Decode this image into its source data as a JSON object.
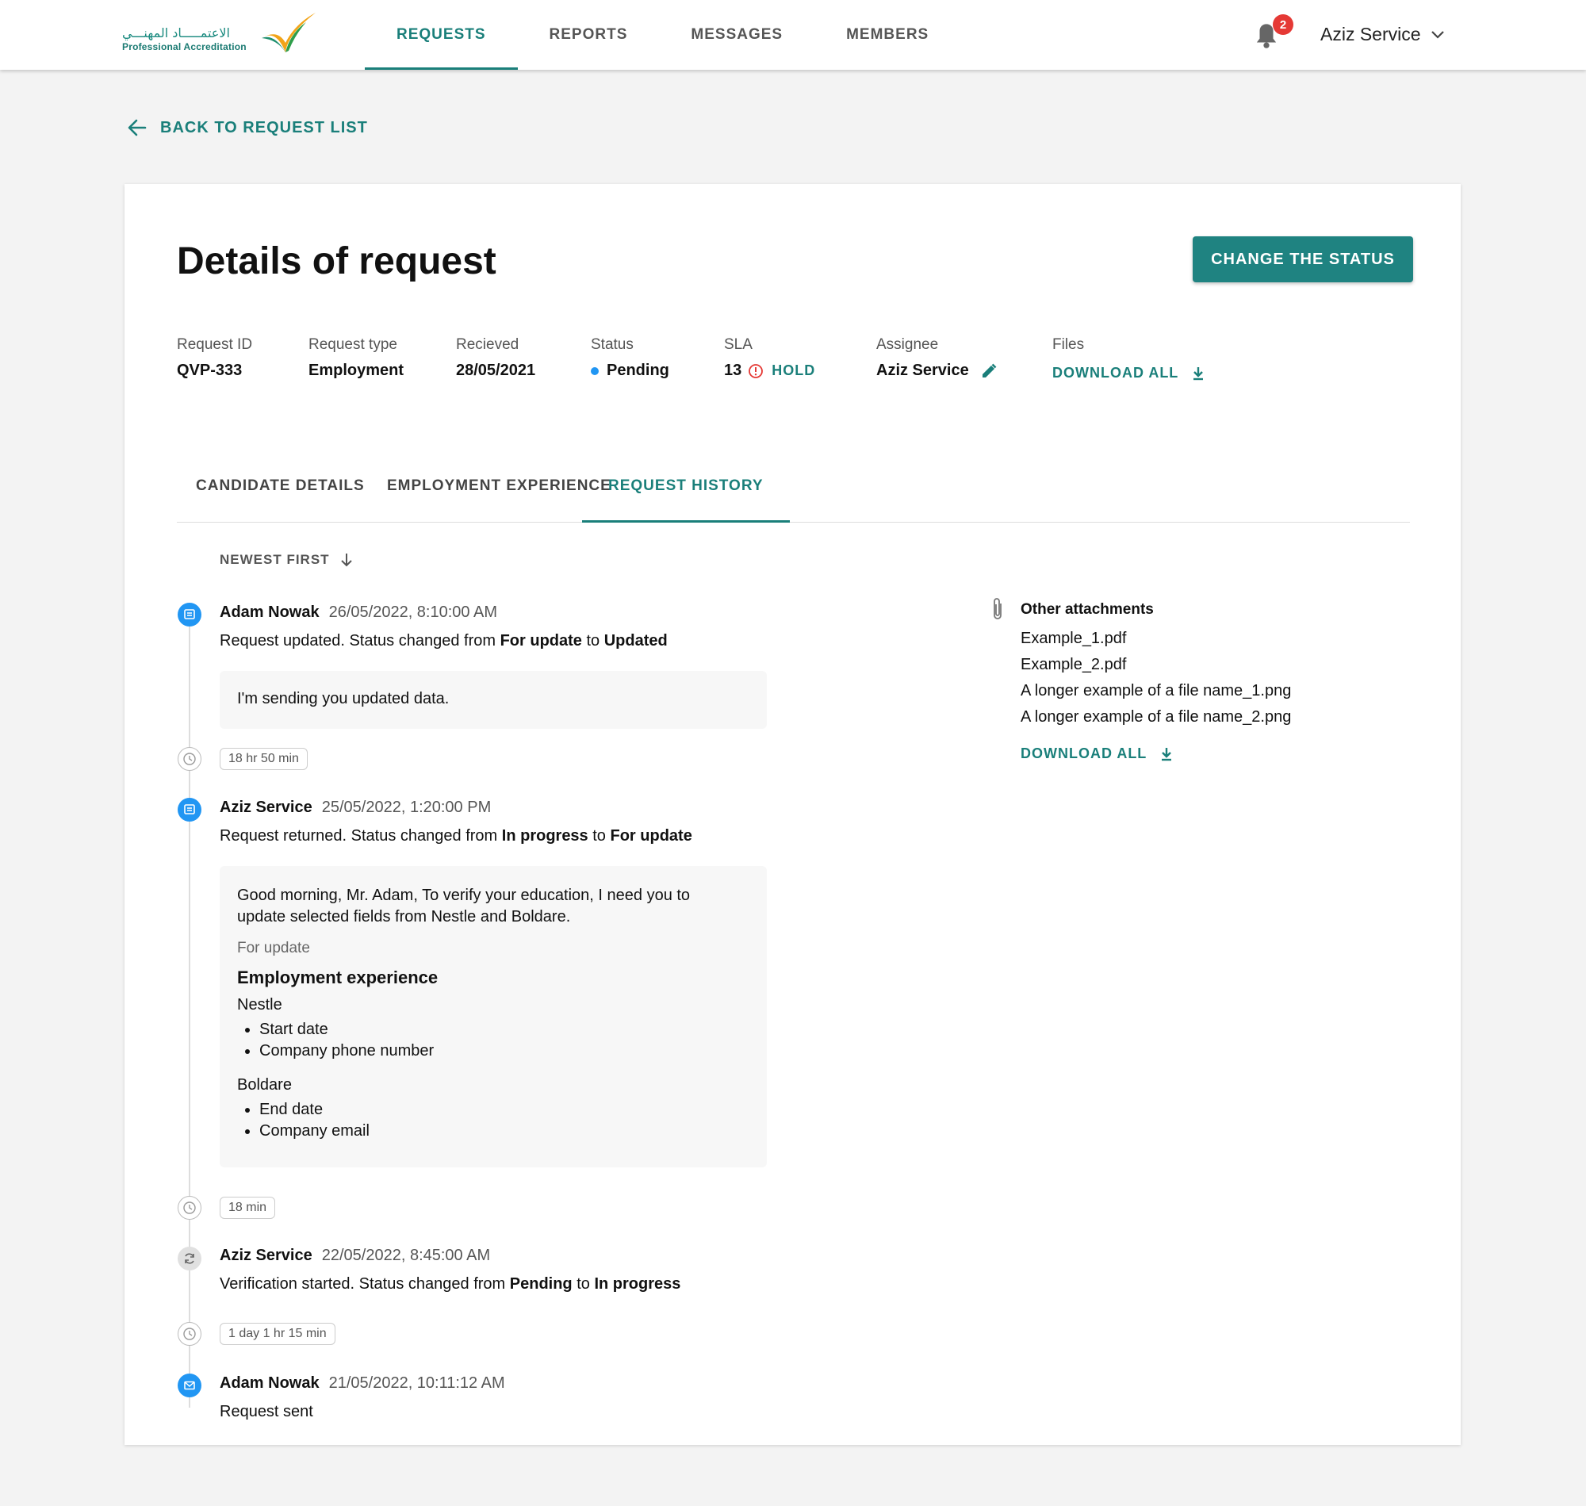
{
  "header": {
    "logo_arabic": "الاعتمـــــاد المهنـــي",
    "logo_english": "Professional Accreditation",
    "nav": [
      {
        "label": "REQUESTS"
      },
      {
        "label": "REPORTS"
      },
      {
        "label": "MESSAGES"
      },
      {
        "label": "MEMBERS"
      }
    ],
    "notifications_count": "2",
    "user_name": "Aziz Service"
  },
  "back_link": "BACK TO REQUEST LIST",
  "page_title": "Details of request",
  "change_status_button": "CHANGE THE STATUS",
  "meta": {
    "request_id": {
      "label": "Request ID",
      "value": "QVP-333"
    },
    "request_type": {
      "label": "Request type",
      "value": "Employment"
    },
    "received": {
      "label": "Recieved",
      "value": "28/05/2021"
    },
    "status": {
      "label": "Status",
      "value": "Pending"
    },
    "sla": {
      "label": "SLA",
      "value": "13",
      "hold": "HOLD"
    },
    "assignee": {
      "label": "Assignee",
      "value": "Aziz Service"
    },
    "files": {
      "label": "Files",
      "download": "DOWNLOAD ALL"
    }
  },
  "tabs": [
    {
      "label": "CANDIDATE DETAILS"
    },
    {
      "label": "EMPLOYMENT EXPERIENCE"
    },
    {
      "label": "REQUEST HISTORY"
    }
  ],
  "sort_label": "NEWEST FIRST",
  "history": [
    {
      "author": "Adam Nowak",
      "date": "26/05/2022, 8:10:00 AM",
      "text_prefix": "Request updated. Status changed from ",
      "from": "For update",
      "to_word": " to ",
      "to": "Updated",
      "message": "I'm sending you updated data."
    },
    {
      "duration": "18 hr 50 min"
    },
    {
      "author": "Aziz Service",
      "date": "25/05/2022, 1:20:00 PM",
      "text_prefix": "Request returned. Status changed from ",
      "from": "In progress",
      "to_word": " to ",
      "to": "For update",
      "message": "Good morning, Mr. Adam, To verify your education, I need you to update selected fields from Nestle and Boldare.",
      "for_update_label": "For update",
      "section_title": "Employment experience",
      "groups": [
        {
          "company": "Nestle",
          "fields": [
            "Start date",
            "Company phone number"
          ]
        },
        {
          "company": "Boldare",
          "fields": [
            "End date",
            "Company email"
          ]
        }
      ]
    },
    {
      "duration": "18 min"
    },
    {
      "author": "Aziz Service",
      "date": "22/05/2022, 8:45:00 AM",
      "text_prefix": "Verification started. Status changed from ",
      "from": "Pending",
      "to_word": " to ",
      "to": "In progress"
    },
    {
      "duration": "1 day 1 hr 15 min"
    },
    {
      "author": "Adam Nowak",
      "date": "21/05/2022, 10:11:12 AM",
      "text": "Request sent"
    }
  ],
  "attachments": {
    "title": "Other attachments",
    "files": [
      "Example_1.pdf",
      "Example_2.pdf",
      "A longer example of a file name_1.png",
      "A longer example of a file name_2.png"
    ],
    "download": "DOWNLOAD ALL"
  },
  "colors": {
    "accent": "#1f8381",
    "status_dot": "#2196f3",
    "badge": "#e53935",
    "hold_icon": "#e53935"
  }
}
